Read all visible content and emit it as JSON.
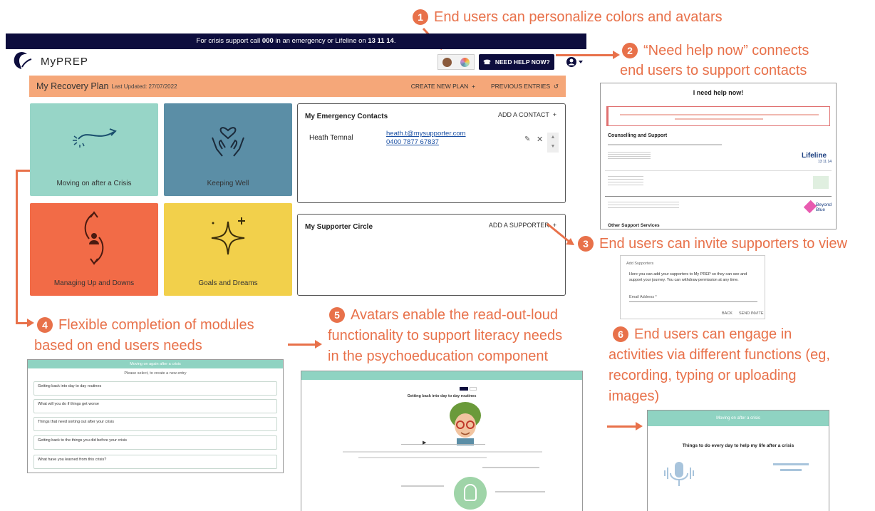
{
  "callouts": {
    "c1": {
      "num": "1",
      "text": "End users can personalize colors and avatars"
    },
    "c2": {
      "num": "2",
      "line1": "“Need help now” connects",
      "line2": "end users to support contacts"
    },
    "c3": {
      "num": "3",
      "text": "End users can invite supporters to view"
    },
    "c4": {
      "num": "4",
      "line1": "Flexible completion of modules",
      "line2": "based on end users needs"
    },
    "c5": {
      "num": "5",
      "line1": "Avatars enable the read-out-loud",
      "line2": "functionality to support literacy needs",
      "line3": "in the psychoeducation component"
    },
    "c6": {
      "num": "6",
      "line1": "End users can engage in",
      "line2": "activities via different functions (eg,",
      "line3": "recording, typing or uploading",
      "line4": "images)"
    }
  },
  "app": {
    "crisis_pre": "For crisis support call ",
    "crisis_num1": "000",
    "crisis_mid": " in an emergency or Lifeline on ",
    "crisis_num2": "13 11 14",
    "crisis_post": ".",
    "brand": "MyPREP",
    "help_label": "NEED HELP NOW?",
    "plan_title": "My Recovery Plan",
    "plan_updated": "Last Updated: 27/07/2022",
    "create_plan": "CREATE NEW PLAN",
    "previous_entries": "PREVIOUS ENTRIES",
    "tiles": [
      {
        "label": "Moving on after a Crisis",
        "color": "#97d5c7"
      },
      {
        "label": "Keeping Well",
        "color": "#5b8ea6"
      },
      {
        "label": "Managing Up and Downs",
        "color": "#f26b47"
      },
      {
        "label": "Goals and Dreams",
        "color": "#f2d04b"
      }
    ],
    "emergency_title": "My Emergency Contacts",
    "add_contact": "ADD A CONTACT",
    "contact_name": "Heath Temnal",
    "contact_email": "heath.t@mysupporter.com",
    "contact_phone": "0400 7877 67837",
    "supporter_title": "My Supporter Circle",
    "add_supporter": "ADD A SUPPORTER"
  },
  "help_now": {
    "title": "I need help now!",
    "counselling": "Counselling and Support",
    "lifeline": "Lifeline",
    "lifeline_num": "13 11 14",
    "beyond": "Beyond Blue",
    "other": "Other Support Services"
  },
  "add_supporters": {
    "title": "Add Supporters",
    "body": "Here you can add your supporters to My PREP so they can see and support your journey. You can withdraw permission at any time.",
    "email_label": "Email Address *",
    "back": "BACK",
    "send": "SEND INVITE"
  },
  "modules_thumb": {
    "header": "Moving on again after a crisis",
    "sub": "Please select, to create a new entry",
    "rows": [
      "Getting back into day to day routines",
      "What will you do if things get worse",
      "Things that need sorting out after your crisis",
      "Getting back to the things you did before your crisis",
      "What have you learned from this crisis?"
    ]
  },
  "avatar_thumb": {
    "heading": "Getting back into day to day routines"
  },
  "activity_thumb": {
    "header": "Moving on after a crisis",
    "prompt": "Things to do every day to help my life after a crisis"
  }
}
